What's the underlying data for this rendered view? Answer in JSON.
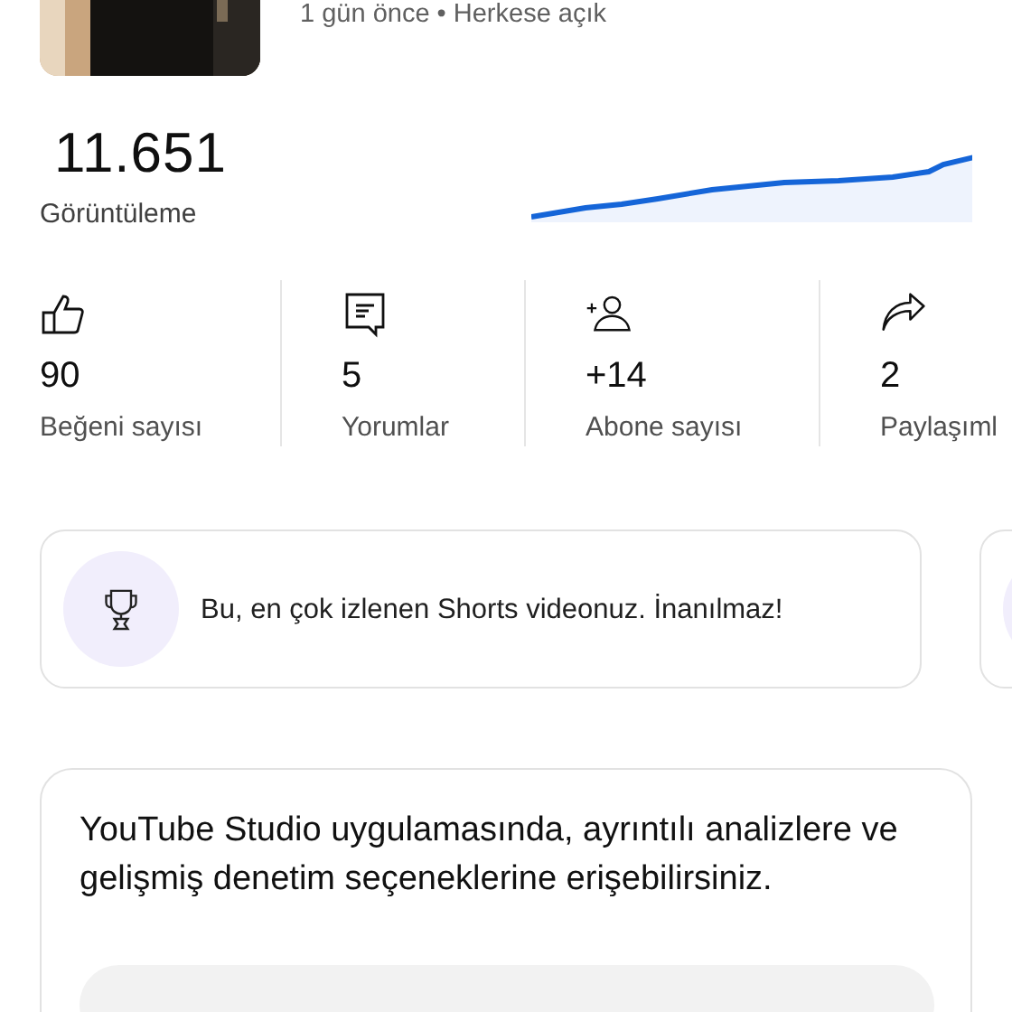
{
  "video": {
    "meta": "1 gün önce • Herkese açık"
  },
  "views": {
    "value": "11.651",
    "label": "Görüntüleme"
  },
  "stats": [
    {
      "kind": "likes",
      "value": "90",
      "label": "Beğeni sayısı"
    },
    {
      "kind": "comments",
      "value": "5",
      "label": "Yorumlar"
    },
    {
      "kind": "subscribers",
      "value": "+14",
      "label": "Abone sayısı"
    },
    {
      "kind": "shares",
      "value": "2",
      "label": "Paylaşıml"
    }
  ],
  "highlights": [
    {
      "kind": "trophy",
      "text": "Bu, en çok izlenen Shorts videonuz. İnanılmaz!"
    },
    {
      "kind": "partial"
    }
  ],
  "promo": {
    "text": "YouTube Studio uygulamasında, ayrıntılı analizlere ve gelişmiş denetim seçeneklerine erişebilirsiniz."
  }
}
